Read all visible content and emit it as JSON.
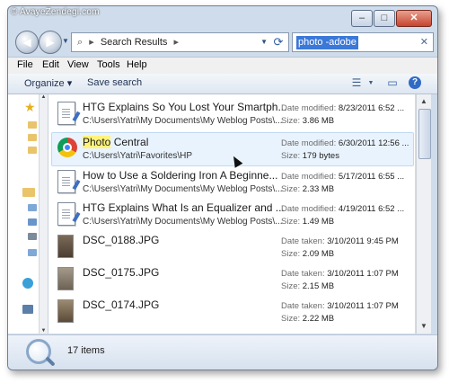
{
  "watermark": "© AvayeZendegi.com",
  "window": {
    "caption_buttons": [
      "–",
      "□",
      "✕"
    ]
  },
  "address_bar": {
    "back_icon": "back-arrow-icon",
    "forward_icon": "forward-arrow-icon",
    "path": "Search Results",
    "separator": "▸",
    "refresh_icon": "⟳",
    "search_query": "photo -adobe",
    "search_clear": "✕"
  },
  "menu": [
    "File",
    "Edit",
    "View",
    "Tools",
    "Help"
  ],
  "toolbar": {
    "organize": "Organize ▾",
    "save_search": "Save search",
    "views_icon": "☰",
    "preview_icon": "▭",
    "help_icon": "?"
  },
  "files": [
    {
      "name": "HTG Explains So You Lost Your Smartph...",
      "path": "C:\\Users\\Yatri\\My Documents\\My Weblog Posts\\...",
      "date_label": "Date modified:",
      "date": "8/23/2011 6:52 ...",
      "size_label": "Size:",
      "size": "3.86 MB",
      "icon": "document-icon"
    },
    {
      "name_hl": "Photo",
      "name_rest": " Central",
      "path": "C:\\Users\\Yatri\\Favorites\\HP",
      "date_label": "Date modified:",
      "date": "6/30/2011 12:56 ...",
      "size_label": "Size:",
      "size": "179 bytes",
      "icon": "chrome-icon"
    },
    {
      "name": "How to Use a Soldering Iron A Beginne...",
      "path": "C:\\Users\\Yatri\\My Documents\\My Weblog Posts\\...",
      "date_label": "Date modified:",
      "date": "5/17/2011 6:55 ...",
      "size_label": "Size:",
      "size": "2.33 MB",
      "icon": "document-icon"
    },
    {
      "name": "HTG Explains What Is an Equalizer and ...",
      "path": "C:\\Users\\Yatri\\My Documents\\My Weblog Posts\\...",
      "date_label": "Date modified:",
      "date": "4/19/2011 6:52 ...",
      "size_label": "Size:",
      "size": "1.49 MB",
      "icon": "document-icon"
    },
    {
      "name": "DSC_0188.JPG",
      "path": "",
      "date_label": "Date taken:",
      "date": "3/10/2011 9:45 PM",
      "size_label": "Size:",
      "size": "2.09 MB",
      "icon": "photo-icon"
    },
    {
      "name": "DSC_0175.JPG",
      "path": "",
      "date_label": "Date taken:",
      "date": "3/10/2011 1:07 PM",
      "size_label": "Size:",
      "size": "2.15 MB",
      "icon": "photo-icon"
    },
    {
      "name": "DSC_0174.JPG",
      "path": "",
      "date_label": "Date taken:",
      "date": "3/10/2011 1:07 PM",
      "size_label": "Size:",
      "size": "2.22 MB",
      "icon": "photo-icon"
    }
  ],
  "status": {
    "count": "17 items"
  },
  "colors": {
    "frame": "#cfdceb",
    "selection": "#e9f3fd",
    "highlight": "#fff37a",
    "search_selection": "#3b78d8"
  }
}
